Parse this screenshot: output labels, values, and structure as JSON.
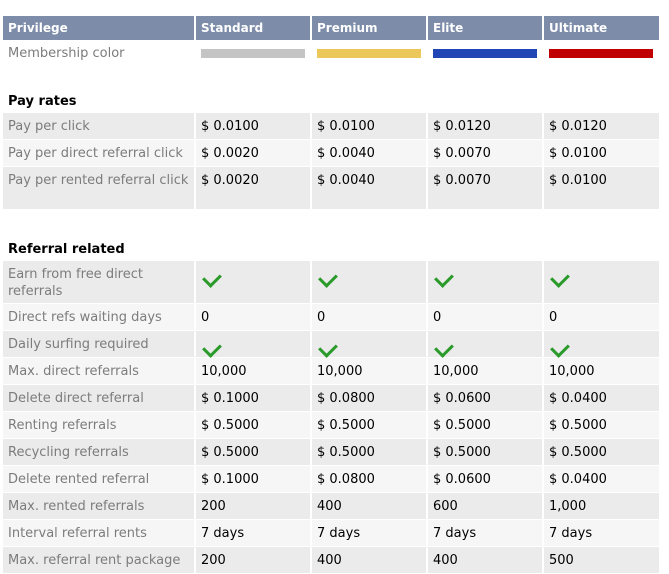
{
  "header": {
    "privilege": "Privilege",
    "plans": [
      "Standard",
      "Premium",
      "Elite",
      "Ultimate"
    ]
  },
  "membership": {
    "label": "Membership color",
    "colors": [
      "#c4c4c4",
      "#ecc85a",
      "#1f46b4",
      "#c00000"
    ]
  },
  "pay_rates": {
    "title": "Pay rates",
    "rows": [
      {
        "label": "Pay per click",
        "values": [
          "$ 0.0100",
          "$ 0.0100",
          "$ 0.0120",
          "$ 0.0120"
        ]
      },
      {
        "label": "Pay per direct referral click",
        "values": [
          "$ 0.0020",
          "$ 0.0040",
          "$ 0.0070",
          "$ 0.0100"
        ]
      },
      {
        "label": "Pay per rented referral click",
        "values": [
          "$ 0.0020",
          "$ 0.0040",
          "$ 0.0070",
          "$ 0.0100"
        ]
      }
    ]
  },
  "referral": {
    "title": "Referral related",
    "rows": [
      {
        "label": "Earn from free direct referrals",
        "values": [
          "check",
          "check",
          "check",
          "check"
        ]
      },
      {
        "label": "Direct refs waiting days",
        "values": [
          "0",
          "0",
          "0",
          "0"
        ]
      },
      {
        "label": "Daily surfing required",
        "values": [
          "check",
          "check",
          "check",
          "check"
        ]
      },
      {
        "label": "Max. direct referrals",
        "values": [
          "10,000",
          "10,000",
          "10,000",
          "10,000"
        ]
      },
      {
        "label": "Delete direct referral",
        "values": [
          "$ 0.1000",
          "$ 0.0800",
          "$ 0.0600",
          "$ 0.0400"
        ]
      },
      {
        "label": "Renting referrals",
        "values": [
          "$ 0.5000",
          "$ 0.5000",
          "$ 0.5000",
          "$ 0.5000"
        ]
      },
      {
        "label": "Recycling referrals",
        "values": [
          "$ 0.5000",
          "$ 0.5000",
          "$ 0.5000",
          "$ 0.5000"
        ]
      },
      {
        "label": "Delete rented referral",
        "values": [
          "$ 0.1000",
          "$ 0.0800",
          "$ 0.0600",
          "$ 0.0400"
        ]
      },
      {
        "label": "Max. rented referrals",
        "values": [
          "200",
          "400",
          "600",
          "1,000"
        ]
      },
      {
        "label": "Interval referral rents",
        "values": [
          "7 days",
          "7 days",
          "7 days",
          "7 days"
        ]
      },
      {
        "label": "Max. referral rent package",
        "values": [
          "200",
          "400",
          "400",
          "500"
        ]
      }
    ]
  }
}
